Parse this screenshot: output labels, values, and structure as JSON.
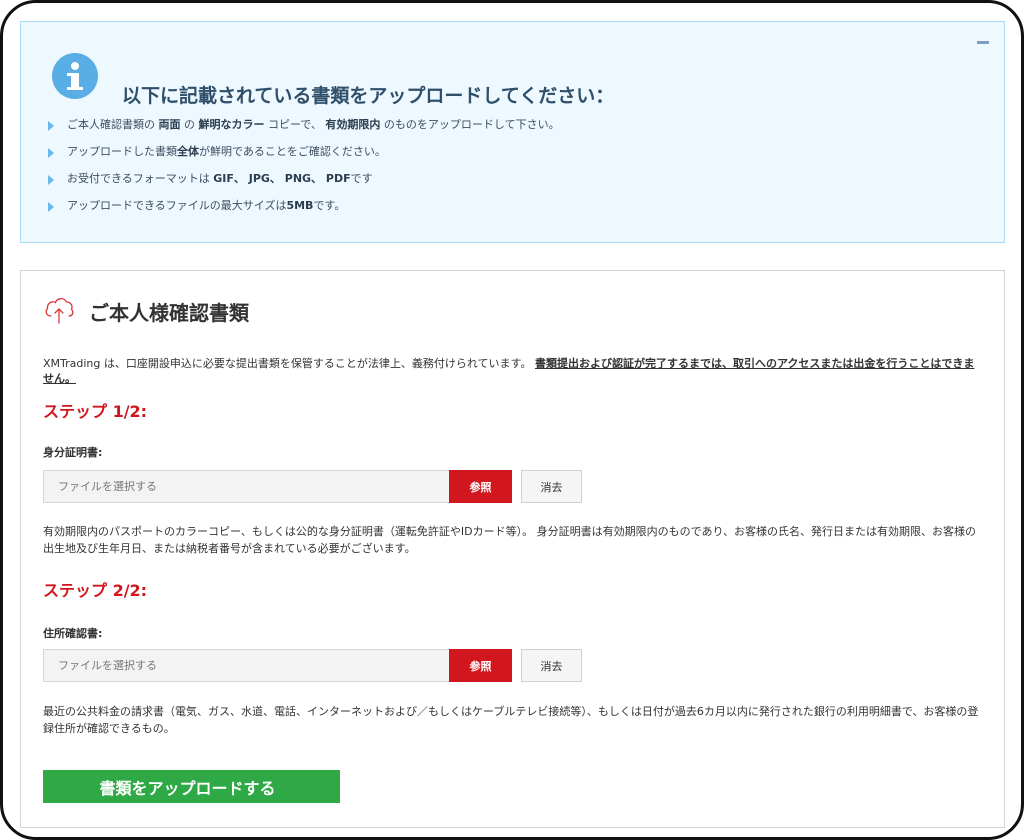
{
  "info": {
    "title": "以下に記載されている書類をアップロードしてください：",
    "collapse_label": "−",
    "items": [
      {
        "a": "ご本人確認書類の ",
        "b1": "両面",
        "c": " の ",
        "b2": "鮮明なカラー",
        "d": " コピーで、 ",
        "b3": "有効期限内",
        "e": " のものをアップロードして下さい。"
      },
      {
        "a": "アップロードした書類",
        "b1": "全体",
        "c": "が鮮明であることをご確認ください。"
      },
      {
        "a": "お受付できるフォーマットは ",
        "b1": "GIF、 JPG、 PNG、 PDF",
        "c": "です"
      },
      {
        "a": "アップロードできるファイルの最大サイズは",
        "b1": "5MB",
        "c": "です。"
      }
    ]
  },
  "upload": {
    "title": "ご本人様確認書類",
    "intro": "XMTrading は、口座開設申込に必要な提出書類を保管することが法律上、義務付けられています。 ",
    "intro_emph": "書類提出および認証が完了するまでは、取引へのアクセスまたは出金を行うことはできません。",
    "step1": {
      "title": "ステップ 1/2:",
      "label": "身分証明書:",
      "placeholder": "ファイルを選択する",
      "browse": "参照",
      "clear": "消去",
      "description": "有効期限内のパスポートのカラーコピー、もしくは公的な身分証明書（運転免許証やIDカード等）。 身分証明書は有効期限内のものであり、お客様の氏名、発行日または有効期限、お客様の出生地及び生年月日、または納税者番号が含まれている必要がございます。"
    },
    "step2": {
      "title": "ステップ 2/2:",
      "label": "住所確認書:",
      "placeholder": "ファイルを選択する",
      "browse": "参照",
      "clear": "消去",
      "description": "最近の公共料金の請求書（電気、ガス、水道、電話、インターネットおよび／もしくはケーブルテレビ接続等）、もしくは日付が過去6カ月以内に発行された銀行の利用明細書で、お客様の登録住所が確認できるもの。"
    },
    "submit": "書類をアップロードする"
  },
  "colors": {
    "accent_red": "#d1171d",
    "submit_green": "#2ea945",
    "info_blue": "#5aaee6",
    "info_bg": "#eef8ff"
  },
  "icons": {
    "info": "info-circle-icon",
    "upload": "cloud-upload-icon",
    "bullet": "triangle-right-icon"
  }
}
